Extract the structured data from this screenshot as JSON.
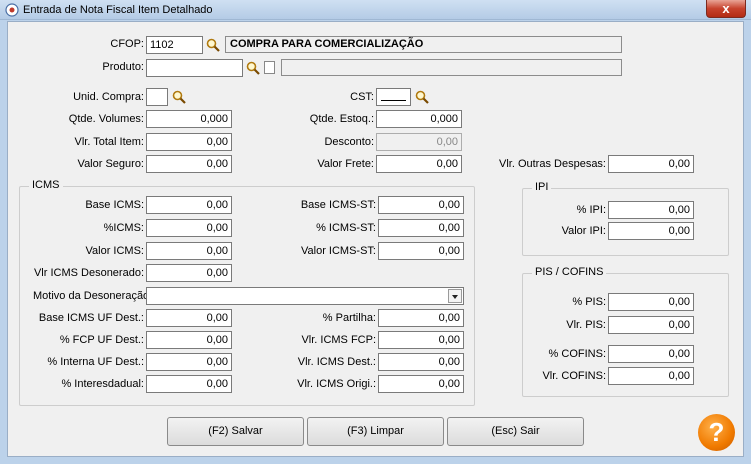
{
  "window": {
    "title": "Entrada de Nota Fiscal Item Detalhado",
    "close": "x"
  },
  "form": {
    "cfop_label": "CFOP:",
    "cfop_value": "1102",
    "cfop_desc": "COMPRA PARA COMERCIALIZAÇÃO",
    "produto_label": "Produto:",
    "produto_value": "",
    "produto_desc": "",
    "unid_compra_label": "Unid. Compra:",
    "unid_compra_value": "",
    "cst_label": "CST:",
    "qtde_volumes_label": "Qtde. Volumes:",
    "qtde_volumes_value": "0,000",
    "qtde_estoq_label": "Qtde. Estoq.:",
    "qtde_estoq_value": "0,000",
    "vlr_total_item_label": "Vlr. Total Item:",
    "vlr_total_item_value": "0,00",
    "desconto_label": "Desconto:",
    "desconto_value": "0,00",
    "valor_seguro_label": "Valor Seguro:",
    "valor_seguro_value": "0,00",
    "valor_frete_label": "Valor Frete:",
    "valor_frete_value": "0,00",
    "vlr_outras_label": "Vlr. Outras Despesas:",
    "vlr_outras_value": "0,00"
  },
  "icms": {
    "legend": "ICMS",
    "base_icms_label": "Base ICMS:",
    "base_icms_value": "0,00",
    "pct_icms_label": "%ICMS:",
    "pct_icms_value": "0,00",
    "valor_icms_label": "Valor ICMS:",
    "valor_icms_value": "0,00",
    "base_icms_st_label": "Base ICMS-ST:",
    "base_icms_st_value": "0,00",
    "pct_icms_st_label": "% ICMS-ST:",
    "pct_icms_st_value": "0,00",
    "valor_icms_st_label": "Valor ICMS-ST:",
    "valor_icms_st_value": "0,00",
    "vlr_desonerado_label": "Vlr ICMS Desonerado:",
    "vlr_desonerado_value": "0,00",
    "motivo_label": "Motivo da Desoneração:",
    "motivo_value": "",
    "base_uf_dest_label": "Base ICMS UF Dest.:",
    "base_uf_dest_value": "0,00",
    "fcp_uf_dest_label": "% FCP UF Dest.:",
    "fcp_uf_dest_value": "0,00",
    "interna_uf_dest_label": "% Interna UF Dest.:",
    "interna_uf_dest_value": "0,00",
    "interestadual_label": "% Interesdadual:",
    "interestadual_value": "0,00",
    "partilha_label": "% Partilha:",
    "partilha_value": "0,00",
    "vlr_fcp_label": "Vlr. ICMS FCP:",
    "vlr_fcp_value": "0,00",
    "vlr_dest_label": "Vlr. ICMS Dest.:",
    "vlr_dest_value": "0,00",
    "vlr_origi_label": "Vlr. ICMS Origi.:",
    "vlr_origi_value": "0,00"
  },
  "ipi": {
    "legend": "IPI",
    "pct_ipi_label": "% IPI:",
    "pct_ipi_value": "0,00",
    "valor_ipi_label": "Valor IPI:",
    "valor_ipi_value": "0,00"
  },
  "pis_cofins": {
    "legend": "PIS / COFINS",
    "pct_pis_label": "% PIS:",
    "pct_pis_value": "0,00",
    "vlr_pis_label": "Vlr. PIS:",
    "vlr_pis_value": "0,00",
    "pct_cofins_label": "% COFINS:",
    "pct_cofins_value": "0,00",
    "vlr_cofins_label": "Vlr. COFINS:",
    "vlr_cofins_value": "0,00"
  },
  "buttons": {
    "salvar": "(F2) Salvar",
    "limpar": "(F3) Limpar",
    "sair": "(Esc) Sair",
    "help": "?"
  },
  "icons": {
    "search": "search-icon",
    "document": "document-icon",
    "help": "help-icon",
    "app": "app-icon"
  }
}
